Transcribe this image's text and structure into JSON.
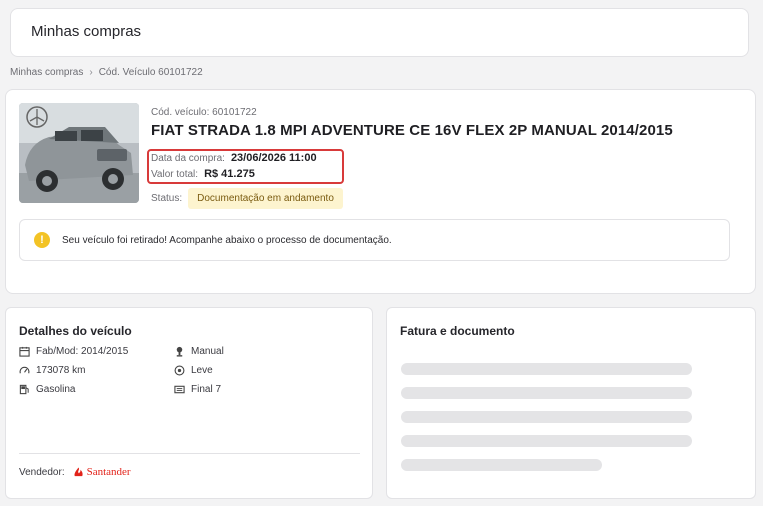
{
  "header": {
    "title": "Minhas compras"
  },
  "breadcrumb": {
    "items": [
      "Minhas compras",
      "Cód. Veículo 60101722"
    ]
  },
  "vehicle": {
    "code": "Cód. veículo: 60101722",
    "title": "FIAT STRADA 1.8 MPI ADVENTURE CE 16V FLEX 2P MANUAL 2014/2015",
    "purchase_date_label": "Data da compra:",
    "purchase_date": "23/06/2026 11:00",
    "total_label": "Valor total:",
    "total": "R$ 41.275",
    "status_label": "Status:",
    "status": "Documentação em andamento"
  },
  "alert": {
    "icon": "warning-icon",
    "text": "Seu veículo foi retirado! Acompanhe abaixo o processo de documentação."
  },
  "details": {
    "title": "Detalhes do veículo",
    "specs": [
      {
        "icon": "calendar-icon",
        "text": "Fab/Mod: 2014/2015"
      },
      {
        "icon": "gearshift-icon",
        "text": "Manual"
      },
      {
        "icon": "speedometer-icon",
        "text": "173078 km"
      },
      {
        "icon": "damage-icon",
        "text": "Leve"
      },
      {
        "icon": "fuel-icon",
        "text": "Gasolina"
      },
      {
        "icon": "plate-icon",
        "text": "Final 7"
      }
    ],
    "seller_label": "Vendedor:",
    "seller_name": "Santander"
  },
  "documents": {
    "title": "Fatura e documento",
    "loading_rows": 5
  },
  "colors": {
    "highlight": "#d83a3a",
    "status_bg": "#fdf4cf",
    "alert_icon": "#f3c325",
    "brand_red": "#e2231a"
  }
}
